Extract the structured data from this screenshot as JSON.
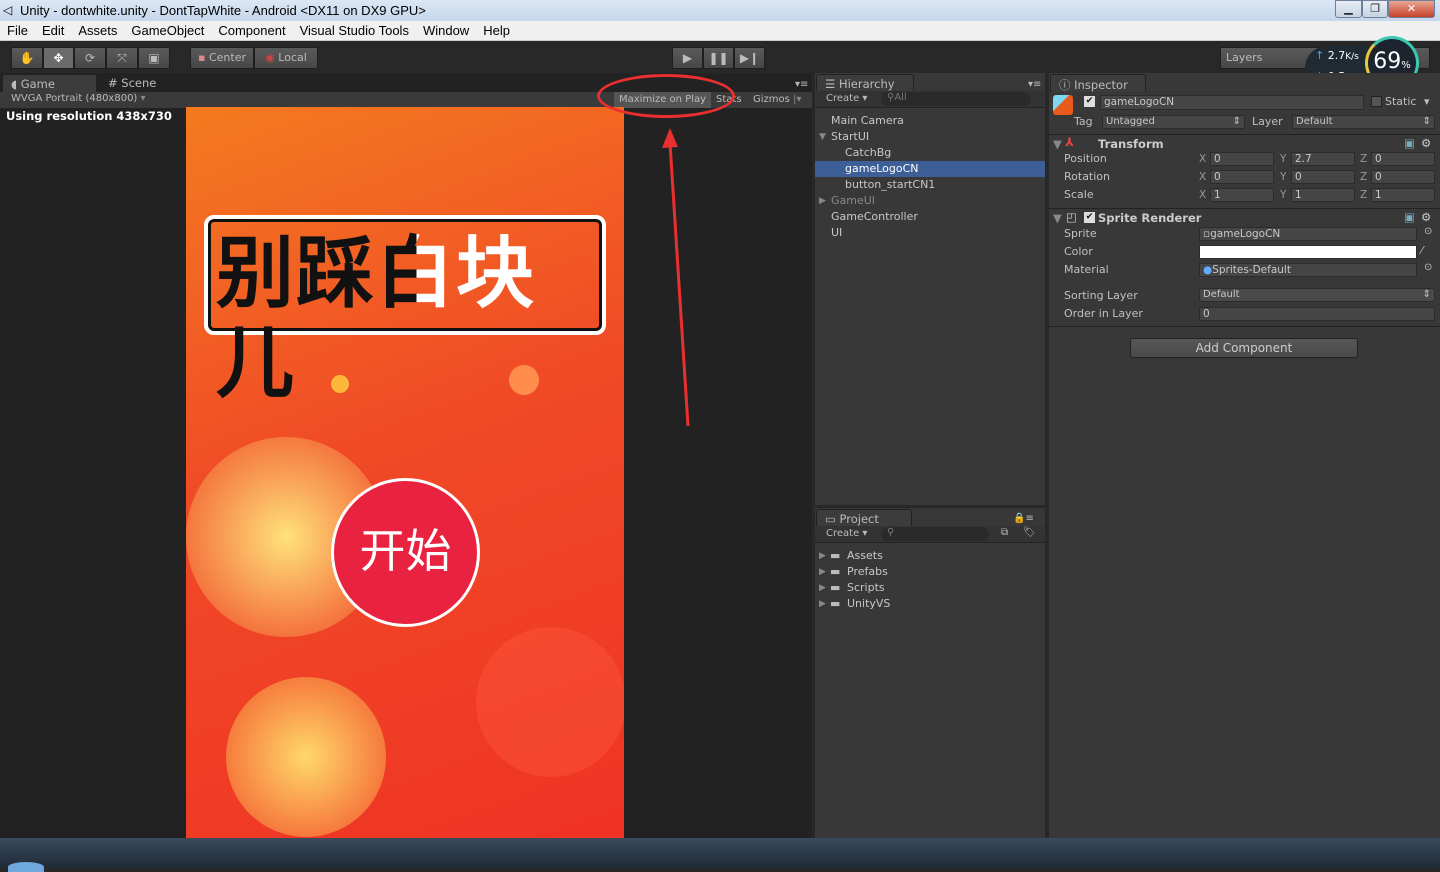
{
  "window": {
    "title": "Unity - dontwhite.unity - DontTapWhite - Android <DX11 on DX9 GPU>"
  },
  "menu": [
    "File",
    "Edit",
    "Assets",
    "GameObject",
    "Component",
    "Visual Studio Tools",
    "Window",
    "Help"
  ],
  "toolbar": {
    "pivot": "Center",
    "space": "Local",
    "layers": "Layers"
  },
  "network_widget": {
    "upload": "2.7",
    "download": "0.5",
    "unit": "K/s",
    "percent": "69",
    "percent_sign": "%"
  },
  "game": {
    "tab_game": "Game",
    "tab_scene": "Scene",
    "resolution_select": "WVGA Portrait (480x800)",
    "maximize": "Maximize on Play",
    "stats": "Stats",
    "gizmos": "Gizmos",
    "resolution_note": "Using resolution 438x730",
    "logo_text": "别踩白块儿",
    "start_button": "开始",
    "gradient_top": "#f47a20",
    "gradient_bottom": "#ef3324",
    "button_color": "#e8223f"
  },
  "annotation": {
    "color": "#e83030"
  },
  "hierarchy": {
    "tab": "Hierarchy",
    "create": "Create",
    "search_placeholder": "All",
    "items": [
      {
        "label": "Main Camera",
        "indent": 0,
        "arrow": ""
      },
      {
        "label": "StartUI",
        "indent": 0,
        "arrow": "▼"
      },
      {
        "label": "CatchBg",
        "indent": 1,
        "arrow": ""
      },
      {
        "label": "gameLogoCN",
        "indent": 1,
        "arrow": "",
        "selected": true
      },
      {
        "label": "button_startCN1",
        "indent": 1,
        "arrow": ""
      },
      {
        "label": "GameUI",
        "indent": 0,
        "arrow": "▶",
        "dim": true
      },
      {
        "label": "GameController",
        "indent": 0,
        "arrow": ""
      },
      {
        "label": "UI",
        "indent": 0,
        "arrow": ""
      }
    ]
  },
  "project": {
    "tab": "Project",
    "create": "Create",
    "folders": [
      "Assets",
      "Prefabs",
      "Scripts",
      "UnityVS"
    ]
  },
  "inspector": {
    "tab": "Inspector",
    "object_name": "gameLogoCN",
    "static": "Static",
    "tag_label": "Tag",
    "tag": "Untagged",
    "layer_label": "Layer",
    "layer": "Default",
    "transform": {
      "title": "Transform",
      "rows": [
        {
          "label": "Position",
          "x": "0",
          "y": "2.7",
          "z": "0"
        },
        {
          "label": "Rotation",
          "x": "0",
          "y": "0",
          "z": "0"
        },
        {
          "label": "Scale",
          "x": "1",
          "y": "1",
          "z": "1"
        }
      ]
    },
    "sprite_renderer": {
      "title": "Sprite Renderer",
      "sprite_label": "Sprite",
      "sprite": "gameLogoCN",
      "color_label": "Color",
      "color": "#ffffff",
      "material_label": "Material",
      "material": "Sprites-Default",
      "sorting_label": "Sorting Layer",
      "sorting": "Default",
      "order_label": "Order in Layer",
      "order": "0"
    },
    "add_component": "Add Component"
  }
}
